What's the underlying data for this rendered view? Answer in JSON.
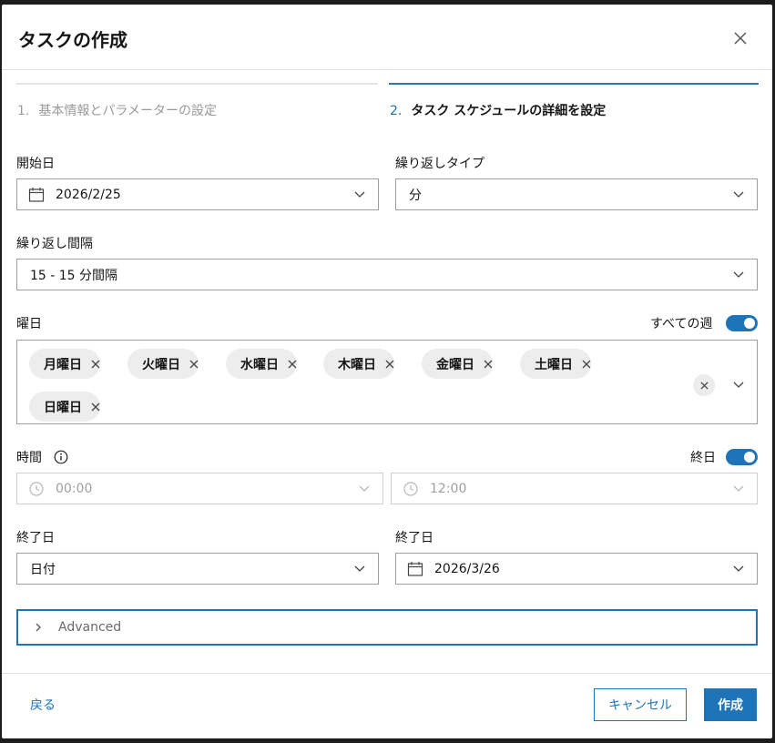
{
  "dialog": {
    "title": "タスクの作成",
    "close_icon": "close-icon"
  },
  "steps": [
    {
      "num": "1.",
      "label": "基本情報とパラメーターの設定",
      "active": false
    },
    {
      "num": "2.",
      "label": "タスク スケジュールの詳細を設定",
      "active": true
    }
  ],
  "start_date": {
    "label": "開始日",
    "value": "2026/2/25",
    "icon": "calendar-icon"
  },
  "recurrence_type": {
    "label": "繰り返しタイプ",
    "value": "分"
  },
  "recurrence_interval": {
    "label": "繰り返し間隔",
    "value": "15 - 15 分間隔"
  },
  "weekdays": {
    "label": "曜日",
    "all_weeks_label": "すべての週",
    "all_weeks_on": true,
    "chips": [
      "月曜日",
      "火曜日",
      "水曜日",
      "木曜日",
      "金曜日",
      "土曜日",
      "日曜日"
    ]
  },
  "time": {
    "label": "時間",
    "info_icon": "info-icon",
    "all_day_label": "終日",
    "all_day_on": true,
    "start": "00:00",
    "end": "12:00",
    "icon": "clock-icon"
  },
  "end_type": {
    "label": "終了日",
    "value": "日付"
  },
  "end_date": {
    "label": "終了日",
    "value": "2026/3/26",
    "icon": "calendar-icon"
  },
  "advanced": {
    "label": "Advanced"
  },
  "footer": {
    "back_label": "戻る",
    "cancel_label": "キャンセル",
    "create_label": "作成"
  },
  "colors": {
    "accent": "#1f73b7",
    "border": "#9e9e9e",
    "chip_bg": "#ededed"
  }
}
